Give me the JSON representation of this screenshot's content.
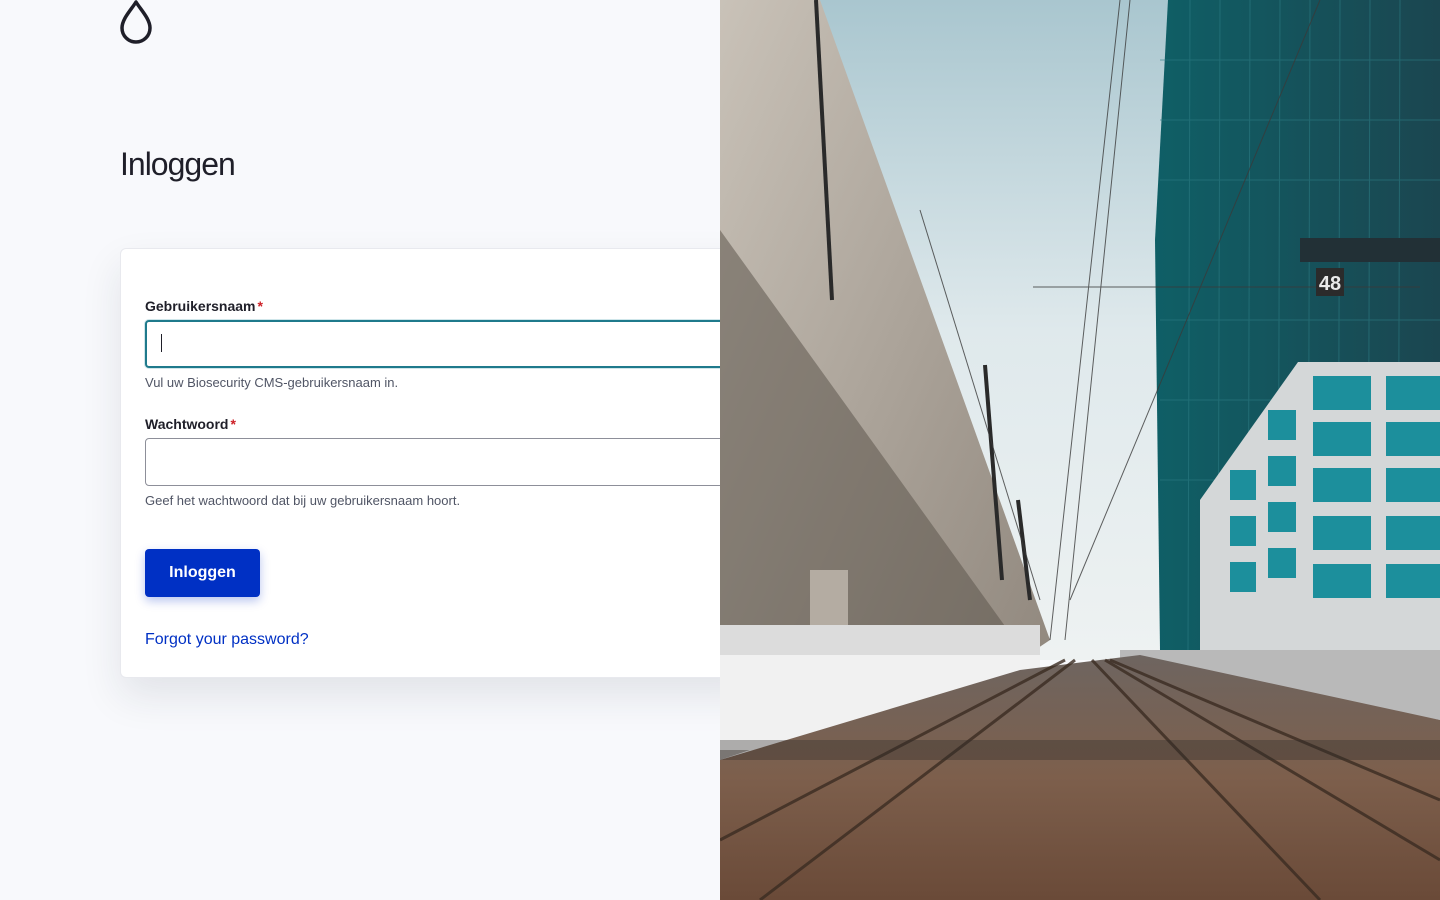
{
  "page": {
    "title": "Inloggen"
  },
  "logo": {
    "icon": "droplet-logo-icon"
  },
  "form": {
    "username": {
      "label": "Gebruikersnaam",
      "required_marker": "*",
      "value": "",
      "help": "Vul uw Biosecurity CMS-gebruikersnaam in."
    },
    "password": {
      "label": "Wachtwoord",
      "required_marker": "*",
      "value": "",
      "help": "Geef het wachtwoord dat bij uw gebruikersnaam hoort."
    },
    "submit_label": "Inloggen",
    "forgot_label": "Forgot your password?"
  },
  "photo": {
    "sign_text": "48"
  },
  "colors": {
    "accent": "#0030c4",
    "focus_ring": "#1f7a8c",
    "required": "#cd2026",
    "background": "#f8f9fc"
  }
}
